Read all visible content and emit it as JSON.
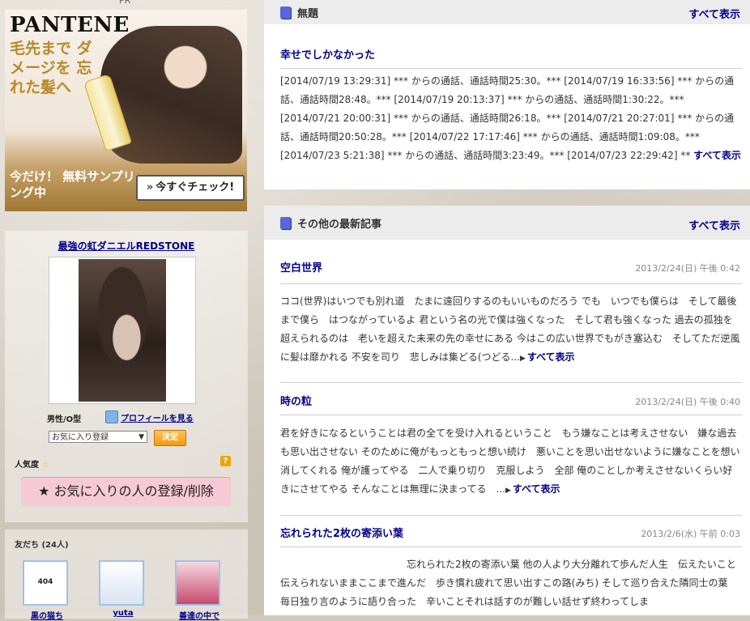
{
  "ad": {
    "pr_label": "PR",
    "brand": "PANTENE",
    "copy": "毛先まで ダメージを 忘れた髪へ",
    "promo": "今だけ！ 無料サンプリング中",
    "cta": "今すぐチェック!"
  },
  "profile": {
    "name": "最強の虹ダニエルREDSTONE",
    "gender": "男性/O型",
    "profile_link": "プロフィールを見る",
    "select_value": "お気に入り登録",
    "decide": "決定",
    "popularity": "人気度",
    "fav_button": "★ お気に入りの人の登録/削除"
  },
  "friends": {
    "title": "友だち (24人)",
    "items": [
      {
        "name": "黒の猫ち",
        "thumb_text": "404"
      },
      {
        "name": "yuta",
        "thumb_text": ""
      },
      {
        "name": "善達の中で",
        "thumb_text": ""
      }
    ]
  },
  "panel1": {
    "title": "無題",
    "more": "すべて表示",
    "entry_title": "幸せでしかなかった",
    "body": "[2014/07/19 13:29:31] *** からの通話、通話時間25:30。*** [2014/07/19 16:33:56] *** からの通話、通話時間28:48。*** [2014/07/19 20:13:37] *** からの通話、通話時間1:30:22。*** [2014/07/21 20:00:31] *** からの通話、通話時間26:18。*** [2014/07/21 20:27:01] *** からの通話、通話時間20:50:28。*** [2014/07/22 17:17:46] *** からの通話、通話時間1:09:08。*** [2014/07/23 5:21:38] *** からの通話、通話時間3:23:49。*** [2014/07/23 22:29:42] ** ",
    "inline_more": "すべて表示"
  },
  "panel2": {
    "title": "その他の最新記事",
    "more": "すべて表示",
    "entries": [
      {
        "title": "空白世界",
        "date": "2013/2/24(日) 午後 0:42",
        "body": "ココ(世界)はいつでも別れ道　たまに遠回りするのもいいものだろう でも　いつでも僕らは　そして最後まで僕ら　はつながっているよ 君という名の光で僕は強くなった　そして君も強くなった 過去の孤独を超えられるのは　老いを超えた未来の先の幸せにある 今はこの広い世界でもがき塞込む　そしてただ逆風に髪は靡かれる 不安を司り　悲しみは集どる(つどる...",
        "more": "すべて表示"
      },
      {
        "title": "時の粒",
        "date": "2013/2/24(日) 午後 0:40",
        "body": "君を好きになるということは君の全てを受け入れるということ　もう嫌なことは考えさせない　嫌な過去も思い出させない そのために俺がもっともっと想い続け　悪いことを思い出せないように嫌なことを想い消してくれる 俺が護ってやる　二人で乗り切り　克服しよう　全部 俺のことしか考えさせないくらい好きにさせてやる そんなことは無理に決まってる　...",
        "more": "すべて表示"
      },
      {
        "title": "忘れられた2枚の寄添い葉",
        "date": "2013/2/6(水) 午前 0:03",
        "body": "　　　　　　　　　　　　　忘れられた2枚の寄添い葉 他の人より大分離れて歩んだ人生　伝えたいこと伝えられないままここまで進んだ　歩き慣れ疲れて思い出すこの路(みち) そして巡り合えた隣同士の葉　毎日独り言のように語り合った　辛いことそれは話すのが難しい話せず終わってしま",
        "more": ""
      }
    ]
  },
  "colors": {
    "link": "#00008b",
    "button_orange": "#f29a0c",
    "fav_pink": "#f6c9d6"
  }
}
